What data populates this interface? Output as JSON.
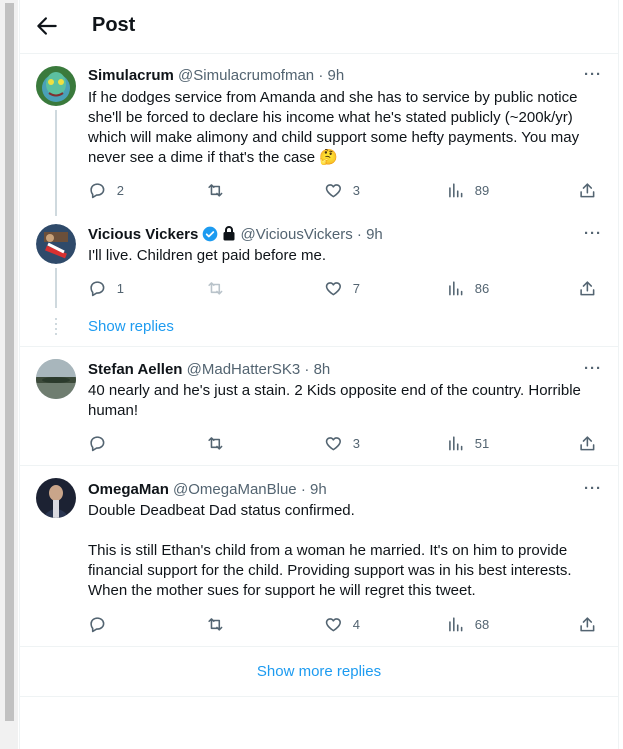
{
  "header": {
    "title": "Post",
    "back_icon": "arrow-left-icon"
  },
  "tweets": [
    {
      "name": "Simulacrum",
      "handle": "@Simulacrumofman",
      "time": "· 9h",
      "text": "If he dodges service from Amanda and she has to service by public notice she'll be forced to declare his income what he's stated publicly (~200k/yr) which will make alimony and child support some hefty payments. You may never see a dime if that's the case 🤔",
      "replies": "2",
      "retweets": "",
      "likes": "3",
      "views": "89"
    },
    {
      "name": "Vicious Vickers",
      "handle": "@ViciousVickers",
      "time": "· 9h",
      "text": "I'll live. Children get paid before me.",
      "replies": "1",
      "retweets": "",
      "likes": "7",
      "views": "86"
    },
    {
      "name": "Stefan Aellen",
      "handle": "@MadHatterSK3",
      "time": "· 8h",
      "text": "40 nearly and he's just a stain. 2 Kids opposite end of the country. Horrible human!",
      "replies": "",
      "retweets": "",
      "likes": "3",
      "views": "51"
    },
    {
      "name": "OmegaMan",
      "handle": "@OmegaManBlue",
      "time": "· 9h",
      "text_p1": "Double Deadbeat Dad status confirmed.",
      "text_p2": "This is still Ethan's child from a woman he married.  It's on him to provide financial support for the child.  Providing support was in his best interests.  When the mother sues for support he will regret this tweet.",
      "replies": "",
      "retweets": "",
      "likes": "4",
      "views": "68"
    }
  ],
  "show_replies": "Show replies",
  "show_more_replies": "Show more replies",
  "more_label": "···",
  "colors": {
    "accent": "#1d9bf0",
    "muted": "#536471",
    "verified": "#1d9bf0"
  }
}
